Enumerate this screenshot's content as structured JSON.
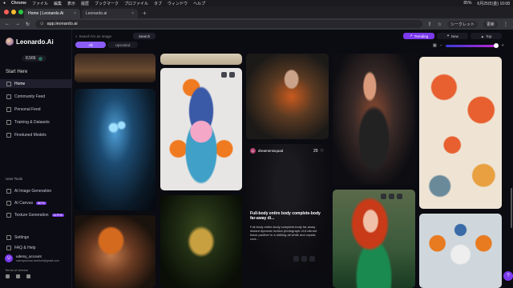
{
  "menubar": {
    "items": [
      "Chrome",
      "ファイル",
      "編集",
      "表示",
      "履歴",
      "ブックマーク",
      "プロファイル",
      "タブ",
      "ウィンドウ",
      "ヘルプ"
    ],
    "battery": "85%",
    "datetime": "6月25日(金) 10:08"
  },
  "browser": {
    "tabs": [
      {
        "title": "Home | Leonardo.Ai"
      },
      {
        "title": "Leonardo.ai"
      }
    ],
    "new_tab": "+",
    "url": "app.leonardo.ai",
    "incognito_label": "シークレット",
    "update_label": "更新"
  },
  "sidebar": {
    "brand": "Leonardo.Ai",
    "credits": "8,566",
    "start_title": "Start Here",
    "nav": [
      {
        "label": "Home"
      },
      {
        "label": "Community Feed"
      },
      {
        "label": "Personal Feed"
      },
      {
        "label": "Training & Datasets"
      },
      {
        "label": "Finetuned Models"
      }
    ],
    "tools_title": "User Tools",
    "tools": [
      {
        "label": "AI Image Generation",
        "badge": ""
      },
      {
        "label": "AI Canvas",
        "badge": "BETA"
      },
      {
        "label": "Texture Generation",
        "badge": "ALPHA"
      }
    ],
    "bottom": [
      {
        "label": "Settings"
      },
      {
        "label": "FAQ & Help"
      }
    ],
    "logout": "Logout",
    "username": "udemy_account",
    "email": "udemycourse.acc0unt@gmail.com",
    "avatar_initial": "U",
    "terms": "Terms of service"
  },
  "feed": {
    "search_placeholder": "Search for an image",
    "search_button": "Search",
    "filters": [
      "All",
      "Upscaled"
    ],
    "sorts": [
      "Trending",
      "New",
      "Top"
    ],
    "image_size_label": "Image size"
  },
  "featured_card": {
    "username": "dreamerssquad",
    "user_initial": "D",
    "likes": "20",
    "title": "Full-body entire body complete-body far-away di...",
    "description": "Full-body entire-body complete-body far-away distant dynamic motion photograph of A vibrant black panther in a striking all white and crystal cool..."
  },
  "colors": {
    "accent": "#7c3aed",
    "accent_light": "#8b5cf6",
    "app_bg": "#0b0b12"
  }
}
